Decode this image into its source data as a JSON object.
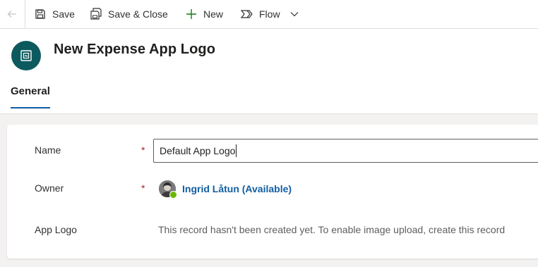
{
  "toolbar": {
    "save_label": "Save",
    "save_close_label": "Save & Close",
    "new_label": "New",
    "flow_label": "Flow"
  },
  "header": {
    "title": "New Expense App Logo",
    "tabs": [
      {
        "label": "General",
        "selected": true
      }
    ]
  },
  "form": {
    "name": {
      "label": "Name",
      "required_marker": "*",
      "value": "Default App Logo"
    },
    "owner": {
      "label": "Owner",
      "required_marker": "*",
      "value": "Ingrid Låtun (Available)",
      "presence": "available"
    },
    "app_logo": {
      "label": "App Logo",
      "message": "This record hasn't been created yet. To enable image upload, create this record"
    }
  },
  "colors": {
    "accent": "#115ea3",
    "entity_icon_bg": "#0c5a5e",
    "required": "#a4262c",
    "presence_available": "#6bb700"
  },
  "icons": [
    "back-arrow-icon",
    "save-icon",
    "save-close-icon",
    "plus-icon",
    "flow-icon",
    "chevron-down-icon",
    "entity-image-icon"
  ]
}
